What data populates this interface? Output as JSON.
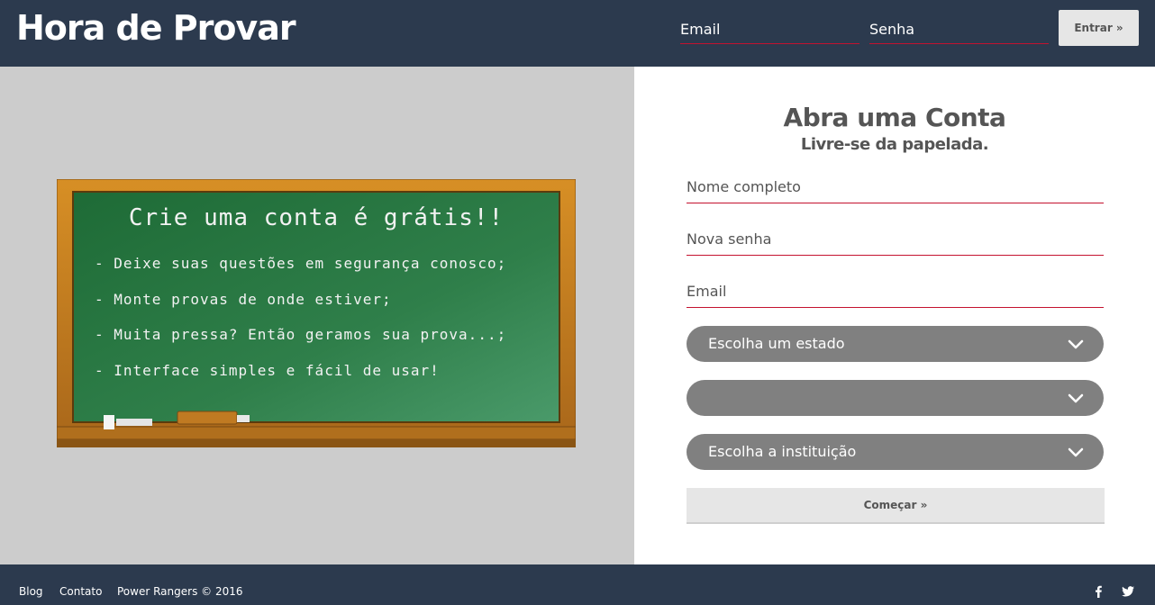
{
  "header": {
    "brand": "Hora de Provar",
    "email_placeholder": "Email",
    "password_placeholder": "Senha",
    "login_label": "Entrar »"
  },
  "chalkboard": {
    "title": "Crie uma conta é grátis!!",
    "lines": [
      "- Deixe suas questões em segurança conosco;",
      "- Monte provas de onde estiver;",
      "- Muita pressa? Então geramos sua prova...;",
      "- Interface simples e fácil de usar!"
    ]
  },
  "signup": {
    "title": "Abra uma Conta",
    "subtitle": "Livre-se da papelada.",
    "name_placeholder": "Nome completo",
    "password_placeholder": "Nova senha",
    "email_placeholder": "Email",
    "state_select": "Escolha um estado",
    "city_select": "",
    "institution_select": "Escolha a instituição",
    "submit_label": "Começar »"
  },
  "footer": {
    "links": [
      "Blog",
      "Contato"
    ],
    "copyright": "Power Rangers © 2016",
    "social_icons": [
      "facebook-icon",
      "twitter-icon"
    ]
  },
  "colors": {
    "navy": "#2c3a4e",
    "accent_red": "#c4122f",
    "select_gray": "#808080",
    "board_green": "#2f7f4a",
    "board_frame": "#c8811c"
  }
}
